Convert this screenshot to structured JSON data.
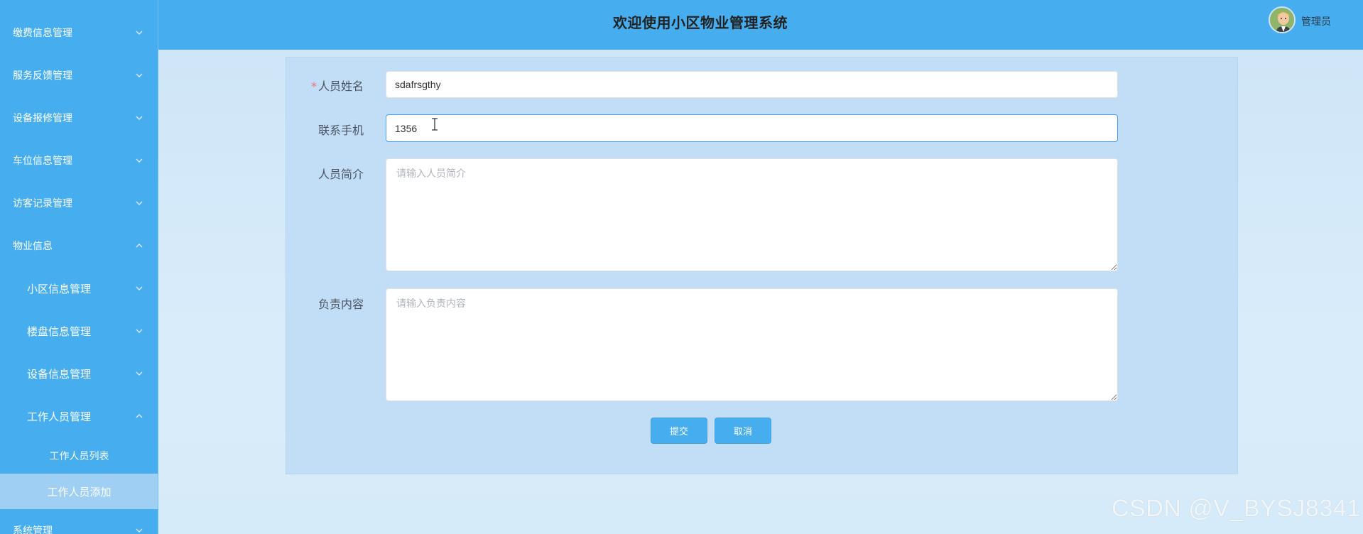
{
  "sidebar": {
    "items": [
      {
        "label": "缴费信息管理",
        "expanded": false
      },
      {
        "label": "服务反馈管理",
        "expanded": false
      },
      {
        "label": "设备报修管理",
        "expanded": false
      },
      {
        "label": "车位信息管理",
        "expanded": false
      },
      {
        "label": "访客记录管理",
        "expanded": false
      },
      {
        "label": "物业信息",
        "expanded": true
      },
      {
        "label": "小区信息管理",
        "expanded": false
      },
      {
        "label": "楼盘信息管理",
        "expanded": false
      },
      {
        "label": "设备信息管理",
        "expanded": false
      },
      {
        "label": "工作人员管理",
        "expanded": true
      },
      {
        "label": "系统管理",
        "expanded": false
      }
    ],
    "leaves": [
      {
        "label": "工作人员列表",
        "active": false
      },
      {
        "label": "工作人员添加",
        "active": true
      }
    ]
  },
  "header": {
    "title": "欢迎使用小区物业管理系统",
    "user_name": "管理员"
  },
  "form": {
    "name_label": "人员姓名",
    "name_required_mark": "*",
    "name_value": "sdafrsgthy",
    "phone_label": "联系手机",
    "phone_value": "1356",
    "intro_label": "人员简介",
    "intro_placeholder": "请输入人员简介",
    "duty_label": "负责内容",
    "duty_placeholder": "请输入负责内容",
    "submit_label": "提交",
    "cancel_label": "取消"
  },
  "watermark": "CSDN @V_BYSJ8341",
  "colors": {
    "sidebar_bg": "#46aeee",
    "header_bg": "#46aeee",
    "active_leaf_bg": "#9fcff3",
    "button_bg": "#46aeee",
    "required": "#f56c6c",
    "focus_border": "#409eff"
  },
  "icons": {
    "chevron_down": "chevron-down-icon",
    "chevron_up": "chevron-up-icon",
    "avatar": "avatar",
    "text_cursor": "text-cursor-icon"
  }
}
